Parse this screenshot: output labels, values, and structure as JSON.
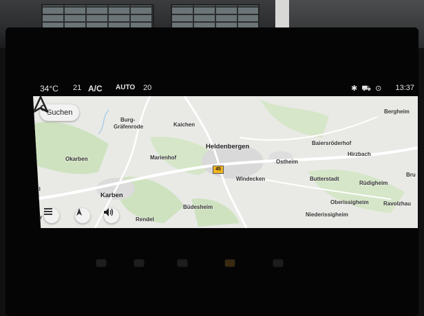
{
  "statusbar": {
    "outside_temp": "34°C",
    "fan_level": "21",
    "ac_label": "A/C",
    "auto_label": "AUTO",
    "set_temp": "20",
    "time": "13:37",
    "icons": [
      "bluetooth-icon",
      "car-icon",
      "location-sound-icon"
    ]
  },
  "map": {
    "search_label": "Suchen",
    "road_number": "45",
    "places": [
      {
        "name": "Bergheim",
        "kind": "small"
      },
      {
        "name": "Burg-",
        "kind": "small"
      },
      {
        "name": "Gräfenrode",
        "kind": "small"
      },
      {
        "name": "Kaichen",
        "kind": "small"
      },
      {
        "name": "Heldenbergen",
        "kind": "city"
      },
      {
        "name": "Baiersröderhof",
        "kind": "small"
      },
      {
        "name": "Hirzbach",
        "kind": "small"
      },
      {
        "name": "Okarben",
        "kind": "small"
      },
      {
        "name": "Marienhof",
        "kind": "small"
      },
      {
        "name": "Ostheim",
        "kind": "small"
      },
      {
        "name": "Windecken",
        "kind": "small"
      },
      {
        "name": "Butterstadt",
        "kind": "small"
      },
      {
        "name": "Rüdigheim",
        "kind": "small"
      },
      {
        "name": "Bru",
        "kind": "small"
      },
      {
        "name": "eil",
        "kind": "small"
      },
      {
        "name": "Karben",
        "kind": "city"
      },
      {
        "name": "Büdesheim",
        "kind": "small"
      },
      {
        "name": "Oberissigheim",
        "kind": "small"
      },
      {
        "name": "Ravolzhau",
        "kind": "small"
      },
      {
        "name": "Gr",
        "kind": "small"
      },
      {
        "name": "Rendel",
        "kind": "small"
      },
      {
        "name": "Niederissigheim",
        "kind": "small"
      }
    ],
    "controls": [
      "menu-icon",
      "compass-icon",
      "volume-icon"
    ]
  },
  "colors": {
    "map_background": "#e9eae6",
    "forest_green": "#cfe2c0",
    "road_badge": "#f3b61f",
    "urban": "#d9d9d9"
  }
}
